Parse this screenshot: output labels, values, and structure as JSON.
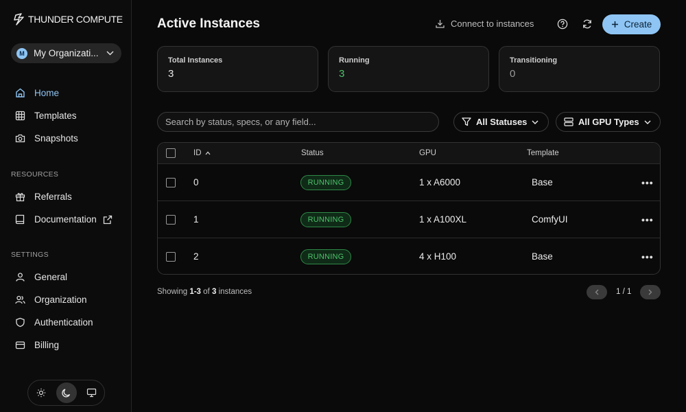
{
  "brand": {
    "name": "THUNDER COMPUTE"
  },
  "org": {
    "initial": "M",
    "name": "My Organizati..."
  },
  "nav": {
    "home": "Home",
    "templates": "Templates",
    "snapshots": "Snapshots",
    "resources_label": "RESOURCES",
    "referrals": "Referrals",
    "documentation": "Documentation",
    "settings_label": "SETTINGS",
    "general": "General",
    "organization": "Organization",
    "authentication": "Authentication",
    "billing": "Billing"
  },
  "theme": {
    "active": "dark",
    "options": [
      "light-icon",
      "moon-icon",
      "monitor-icon"
    ]
  },
  "header": {
    "title": "Active Instances",
    "connect_label": "Connect to instances",
    "create_label": "Create"
  },
  "stats": [
    {
      "label": "Total Instances",
      "value": "3"
    },
    {
      "label": "Running",
      "value": "3"
    },
    {
      "label": "Transitioning",
      "value": "0"
    }
  ],
  "search": {
    "placeholder": "Search by status, specs, or any field..."
  },
  "filters": {
    "status": "All Statuses",
    "gpu": "All GPU Types"
  },
  "table": {
    "columns": {
      "id": "ID",
      "status": "Status",
      "gpu": "GPU",
      "template": "Template"
    },
    "rows": [
      {
        "id": "0",
        "status": "RUNNING",
        "gpu": "1 x A6000",
        "template": "Base"
      },
      {
        "id": "1",
        "status": "RUNNING",
        "gpu": "1 x A100XL",
        "template": "ComfyUI"
      },
      {
        "id": "2",
        "status": "RUNNING",
        "gpu": "4 x H100",
        "template": "Base"
      }
    ]
  },
  "footer": {
    "showing_prefix": "Showing",
    "range": "1-3",
    "of": "of",
    "total": "3",
    "suffix": "instances",
    "page": "1 / 1"
  },
  "colors": {
    "accent": "#8ec5f4",
    "running": "#4cc26a",
    "background": "#0a0a0a"
  }
}
